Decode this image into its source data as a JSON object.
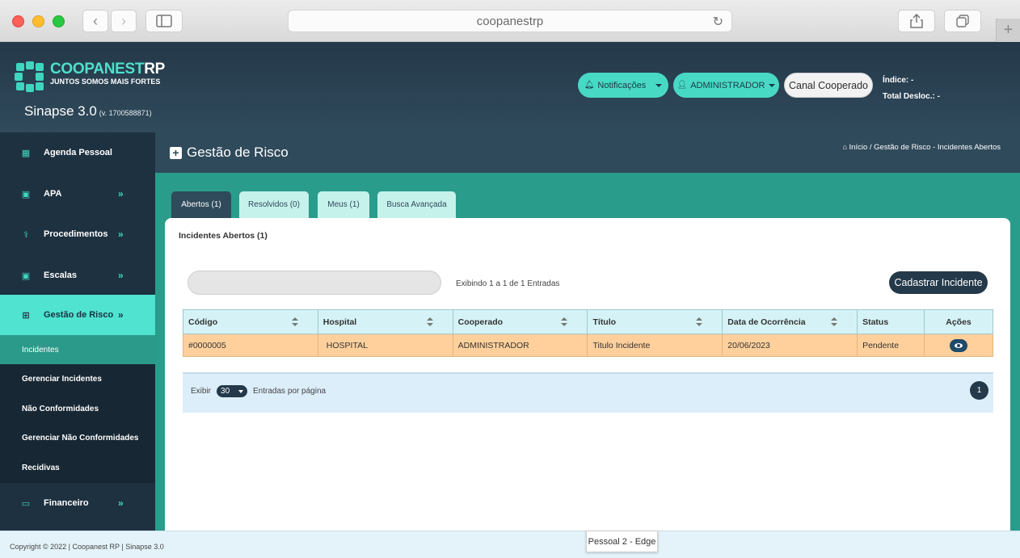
{
  "browser": {
    "url": "coopanestrp"
  },
  "brand": {
    "name_part1": "COOPANEST",
    "name_part2": "RP",
    "tagline": "JUNTOS SOMOS MAIS FORTES",
    "system": "Sinapse 3.0",
    "version": "(v. 1700588871)"
  },
  "header": {
    "notifications": "Notificações",
    "user": "ADMINISTRADOR",
    "channel": "Canal Cooperado",
    "index_label": "Índice: -",
    "total_label": "Total Desloc.: -"
  },
  "sidebar": {
    "items": [
      {
        "label": "Agenda Pessoal",
        "icon": "table-icon"
      },
      {
        "label": "APA",
        "icon": "calendar-icon"
      },
      {
        "label": "Procedimentos",
        "icon": "stethoscope-icon"
      },
      {
        "label": "Escalas",
        "icon": "calendar-icon"
      },
      {
        "label": "Gestão de Risco",
        "icon": "plus-square-icon"
      },
      {
        "label": "Financeiro",
        "icon": "money-icon"
      }
    ],
    "sub_items": [
      {
        "label": "Incidentes"
      },
      {
        "label": "Gerenciar Incidentes"
      },
      {
        "label": "Não Conformidades"
      },
      {
        "label": "Gerenciar Não Conformidades"
      },
      {
        "label": "Recidivas"
      }
    ]
  },
  "page": {
    "title": "Gestão de Risco",
    "breadcrumb": "Início / Gestão de Risco - Incidentes Abertos"
  },
  "tabs": [
    {
      "label": "Abertos (1)"
    },
    {
      "label": "Resolvidos (0)"
    },
    {
      "label": "Meus (1)"
    },
    {
      "label": "Busca Avançada"
    }
  ],
  "card": {
    "title": "Incidentes Abertos (1)",
    "showing": "Exibindo 1 a 1 de 1 Entradas",
    "add_button": "Cadastrar Incidente"
  },
  "table": {
    "columns": [
      "Código",
      "Hospital",
      "Cooperado",
      "Título",
      "Data de Ocorrência",
      "Status",
      "Ações"
    ],
    "rows": [
      {
        "codigo": "#0000005",
        "hospital": "HOSPITAL",
        "cooperado": "ADMINISTRADOR",
        "titulo": "Titulo Incidente",
        "data": "20/06/2023",
        "status": "Pendente"
      }
    ]
  },
  "pagination": {
    "show_label": "Exibir",
    "per_page": "30",
    "per_page_label": "Entradas por página",
    "current_page": "1"
  },
  "footer": {
    "copyright": "Copyright © 2022 | Coopanest RP | Sinapse 3.0",
    "tooltip": "Pessoal 2 - Edge"
  }
}
